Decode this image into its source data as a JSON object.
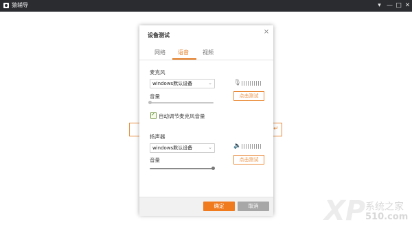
{
  "window": {
    "title": "猿辅导",
    "controls": [
      "▾",
      "—",
      "□",
      "✕"
    ]
  },
  "dialog": {
    "title": "设备测试",
    "close_glyph": "×",
    "tabs": [
      {
        "label": "网络",
        "active": false
      },
      {
        "label": "语音",
        "active": true
      },
      {
        "label": "视频",
        "active": false
      }
    ],
    "microphone": {
      "label": "麦克风",
      "device": "windows默认设备",
      "volume_label": "音量",
      "volume_level": 0.0,
      "auto_adjust_label": "自动调节麦克风音量",
      "auto_adjust_checked": true,
      "test_button": "点击测试"
    },
    "speaker": {
      "label": "扬声器",
      "device": "windows默认设备",
      "volume_label": "音量",
      "volume_level": 1.0,
      "test_button": "点击测试"
    },
    "footer": {
      "ok": "确定",
      "cancel": "取消"
    }
  },
  "watermark": {
    "logo": "XP",
    "site_name": "系统之家",
    "site_num": "510.com"
  },
  "colors": {
    "accent": "#f07b1f",
    "titlebar": "#2a2c30",
    "cancel": "#a7a7a7"
  }
}
